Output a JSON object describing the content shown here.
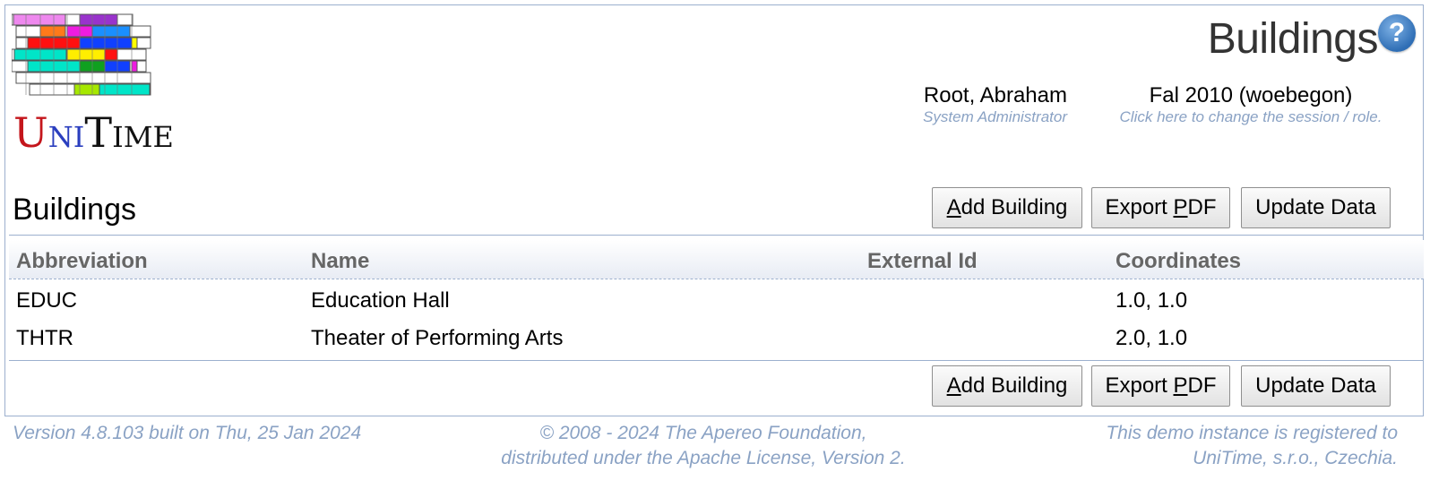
{
  "header": {
    "page_title": "Buildings",
    "help_icon": "question-icon",
    "user": {
      "name": "Root, Abraham",
      "role": "System Administrator"
    },
    "session": {
      "name": "Fal 2010 (woebegon)",
      "hint": "Click here to change the session / role."
    }
  },
  "logo": {
    "letters": [
      "U",
      "NI",
      "T",
      "IME"
    ],
    "colors": [
      "#c4161c",
      "#2b3fbf",
      "#111111",
      "#111111"
    ]
  },
  "section": {
    "title": "Buildings"
  },
  "buttons": {
    "add": {
      "prefix": "",
      "key": "A",
      "rest": "dd Building"
    },
    "export": {
      "prefix": "Export ",
      "key": "P",
      "rest": "DF"
    },
    "update": {
      "label": "Update Data"
    }
  },
  "table": {
    "columns": [
      "Abbreviation",
      "Name",
      "External Id",
      "Coordinates"
    ],
    "rows": [
      {
        "abbreviation": "EDUC",
        "name": "Education Hall",
        "external_id": "",
        "coordinates": "1.0, 1.0"
      },
      {
        "abbreviation": "THTR",
        "name": "Theater of Performing Arts",
        "external_id": "",
        "coordinates": "2.0, 1.0"
      }
    ]
  },
  "footer": {
    "version": "Version 4.8.103 built on Thu, 25 Jan 2024",
    "copyright_line1": "© 2008 - 2024 The Apereo Foundation,",
    "copyright_line2": "distributed under the Apache License, Version 2.",
    "registration_line1": "This demo instance is registered to",
    "registration_line2": "UniTime, s.r.o., Czechia."
  }
}
